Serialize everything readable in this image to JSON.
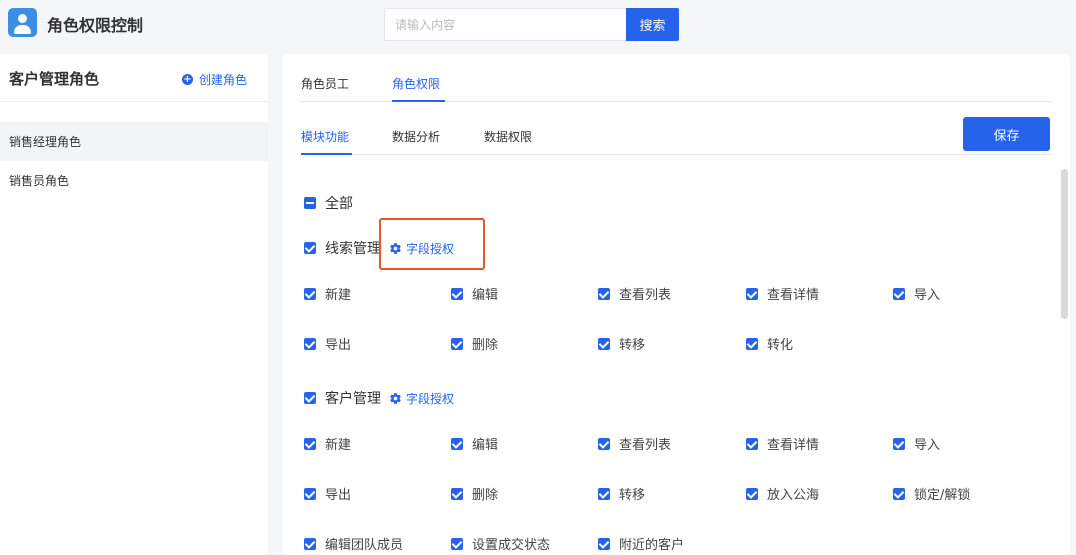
{
  "header": {
    "title": "角色权限控制",
    "search_placeholder": "请输入内容",
    "search_button": "搜索"
  },
  "sidebar": {
    "title": "客户管理角色",
    "create_label": "创建角色",
    "roles": [
      {
        "label": "销售经理角色",
        "active": true
      },
      {
        "label": "销售员角色",
        "active": false
      }
    ]
  },
  "tabs_top": [
    "角色员工",
    "角色权限"
  ],
  "tabs_sub": [
    "模块功能",
    "数据分析",
    "数据权限"
  ],
  "save_label": "保存",
  "all_label": "全部",
  "field_auth_label": "字段授权",
  "sections": [
    {
      "title": "线索管理",
      "rows": [
        [
          "新建",
          "编辑",
          "查看列表",
          "查看详情",
          "导入"
        ],
        [
          "导出",
          "删除",
          "转移",
          "转化"
        ]
      ]
    },
    {
      "title": "客户管理",
      "rows": [
        [
          "新建",
          "编辑",
          "查看列表",
          "查看详情",
          "导入"
        ],
        [
          "导出",
          "删除",
          "转移",
          "放入公海",
          "锁定/解锁"
        ],
        [
          "编辑团队成员",
          "设置成交状态",
          "附近的客户"
        ]
      ]
    }
  ],
  "colors": {
    "accent": "#2563eb",
    "highlight": "#e8542b"
  }
}
